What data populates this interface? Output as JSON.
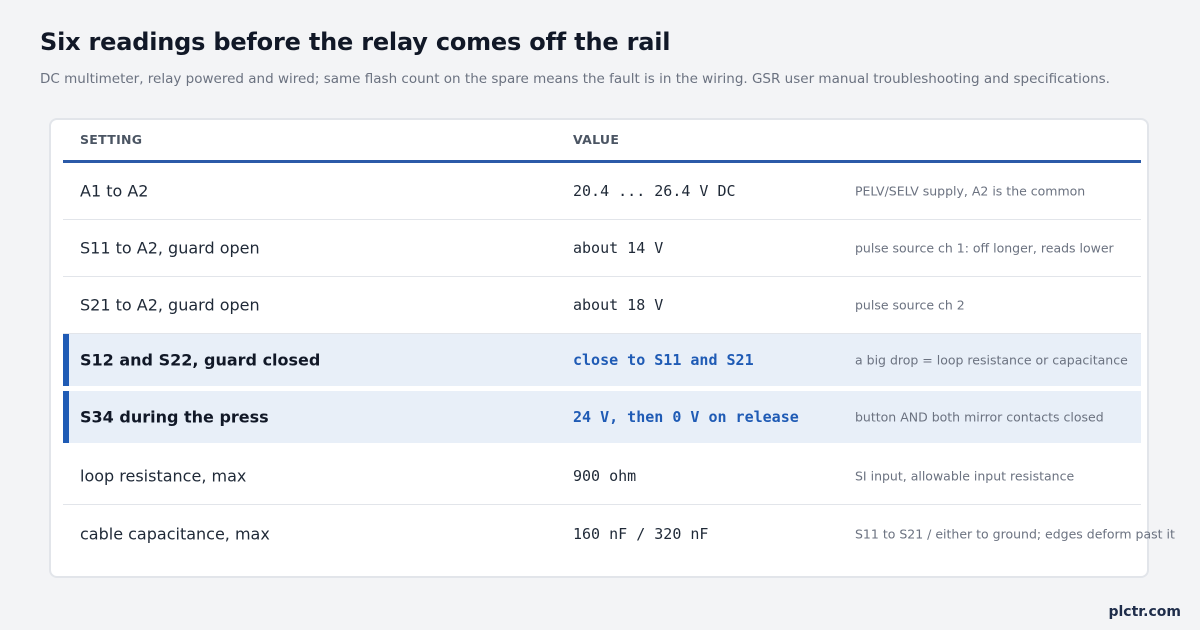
{
  "header": {
    "title": "Six readings before the relay comes off the rail",
    "subtitle": "DC multimeter, relay powered and wired; same flash count on the spare means the fault is in the wiring. GSR user manual troubleshooting and specifications."
  },
  "table": {
    "columns": {
      "setting": "SETTING",
      "value": "VALUE"
    },
    "rows": [
      {
        "setting": "A1 to A2",
        "value": "20.4 ... 26.4 V DC",
        "note": "PELV/SELV supply, A2 is the common",
        "highlighted": false
      },
      {
        "setting": "S11 to A2, guard open",
        "value": "about 14 V",
        "note": "pulse source ch 1: off longer, reads lower",
        "highlighted": false
      },
      {
        "setting": "S21 to A2, guard open",
        "value": "about 18 V",
        "note": "pulse source ch 2",
        "highlighted": false
      },
      {
        "setting": "S12 and S22, guard closed",
        "value": "close to S11 and S21",
        "note": "a big drop = loop resistance or capacitance",
        "highlighted": true
      },
      {
        "setting": "S34 during the press",
        "value": "24 V, then 0 V on release",
        "note": "button AND both mirror contacts closed",
        "highlighted": true
      },
      {
        "setting": "loop resistance, max",
        "value": "900 ohm",
        "note": "SI input, allowable input resistance",
        "highlighted": false
      },
      {
        "setting": "cable capacitance, max",
        "value": "160 nF / 320 nF",
        "note": "S11 to S21 / either to ground; edges deform past it",
        "highlighted": false
      }
    ]
  },
  "footer": {
    "brand": "plctr.com"
  },
  "colors": {
    "accent": "#1f5bb5",
    "header_rule": "#2b5aa8",
    "highlight_bg": "#e8eff8",
    "page_bg": "#f3f4f6"
  }
}
